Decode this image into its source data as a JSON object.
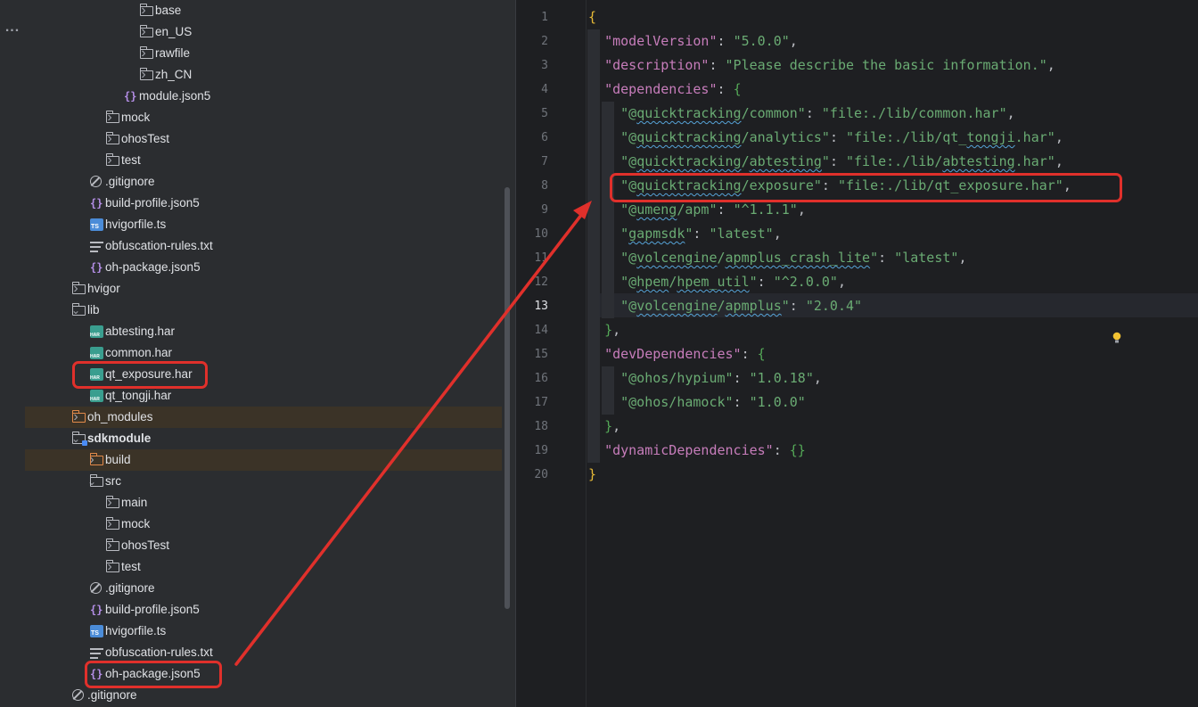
{
  "activity": {
    "more_label": "..."
  },
  "tree": {
    "rows": [
      {
        "label": "base",
        "icon": "folder-icon",
        "chev": "›"
      },
      {
        "label": "en_US",
        "icon": "folder-icon",
        "chev": "›"
      },
      {
        "label": "rawfile",
        "icon": "folder-icon",
        "chev": "›"
      },
      {
        "label": "zh_CN",
        "icon": "folder-icon",
        "chev": "›"
      },
      {
        "label": "module.json5",
        "icon": "json-file-icon",
        "chev": ""
      },
      {
        "label": "mock",
        "icon": "folder-icon",
        "chev": "›"
      },
      {
        "label": "ohosTest",
        "icon": "folder-icon",
        "chev": "›"
      },
      {
        "label": "test",
        "icon": "folder-icon",
        "chev": "›"
      },
      {
        "label": ".gitignore",
        "icon": "ignore-file-icon",
        "chev": ""
      },
      {
        "label": "build-profile.json5",
        "icon": "json-file-icon",
        "chev": ""
      },
      {
        "label": "hvigorfile.ts",
        "icon": "ts-file-icon",
        "chev": ""
      },
      {
        "label": "obfuscation-rules.txt",
        "icon": "text-file-icon",
        "chev": ""
      },
      {
        "label": "oh-package.json5",
        "icon": "json-file-icon",
        "chev": ""
      },
      {
        "label": "hvigor",
        "icon": "folder-icon",
        "chev": "›"
      },
      {
        "label": "lib",
        "icon": "folder-icon",
        "chev": "⌄"
      },
      {
        "label": "abtesting.har",
        "icon": "har-file-icon",
        "chev": ""
      },
      {
        "label": "common.har",
        "icon": "har-file-icon",
        "chev": ""
      },
      {
        "label": "qt_exposure.har",
        "icon": "har-file-icon",
        "chev": ""
      },
      {
        "label": "qt_tongji.har",
        "icon": "har-file-icon",
        "chev": ""
      },
      {
        "label": "oh_modules",
        "icon": "orange-folder-icon",
        "chev": "›"
      },
      {
        "label": "sdkmodule",
        "icon": "module-folder-icon",
        "chev": "⌄"
      },
      {
        "label": "build",
        "icon": "orange-folder-icon",
        "chev": "›"
      },
      {
        "label": "src",
        "icon": "folder-icon",
        "chev": "⌄"
      },
      {
        "label": "main",
        "icon": "folder-icon",
        "chev": "›"
      },
      {
        "label": "mock",
        "icon": "folder-icon",
        "chev": "›"
      },
      {
        "label": "ohosTest",
        "icon": "folder-icon",
        "chev": "›"
      },
      {
        "label": "test",
        "icon": "folder-icon",
        "chev": "›"
      },
      {
        "label": ".gitignore",
        "icon": "ignore-file-icon",
        "chev": ""
      },
      {
        "label": "build-profile.json5",
        "icon": "json-file-icon",
        "chev": ""
      },
      {
        "label": "hvigorfile.ts",
        "icon": "ts-file-icon",
        "chev": ""
      },
      {
        "label": "obfuscation-rules.txt",
        "icon": "text-file-icon",
        "chev": ""
      },
      {
        "label": "oh-package.json5",
        "icon": "json-file-icon",
        "chev": ""
      },
      {
        "label": ".gitignore",
        "icon": "ignore-file-icon",
        "chev": ""
      }
    ]
  },
  "editor": {
    "current_line": 13,
    "line_numbers": [
      "1",
      "2",
      "3",
      "4",
      "5",
      "6",
      "7",
      "8",
      "9",
      "10",
      "11",
      "12",
      "13",
      "14",
      "15",
      "16",
      "17",
      "18",
      "19",
      "20"
    ],
    "lines": [
      [
        {
          "t": "{",
          "c": "b"
        }
      ],
      [
        {
          "t": "  "
        },
        {
          "t": "\"modelVersion\"",
          "c": "k"
        },
        {
          "t": ": "
        },
        {
          "t": "\"5.0.0\"",
          "c": "s"
        },
        {
          "t": ","
        }
      ],
      [
        {
          "t": "  "
        },
        {
          "t": "\"description\"",
          "c": "k"
        },
        {
          "t": ": "
        },
        {
          "t": "\"Please describe the basic information.\"",
          "c": "s"
        },
        {
          "t": ","
        }
      ],
      [
        {
          "t": "  "
        },
        {
          "t": "\"dependencies\"",
          "c": "k"
        },
        {
          "t": ": "
        },
        {
          "t": "{",
          "c": "b2"
        }
      ],
      [
        {
          "t": "    "
        },
        {
          "t": "\"@",
          "c": "s"
        },
        {
          "t": "quicktracking",
          "c": "s",
          "u": true
        },
        {
          "t": "/common\"",
          "c": "s"
        },
        {
          "t": ": "
        },
        {
          "t": "\"file:./lib/common.har\"",
          "c": "s"
        },
        {
          "t": ","
        }
      ],
      [
        {
          "t": "    "
        },
        {
          "t": "\"@",
          "c": "s"
        },
        {
          "t": "quicktracking",
          "c": "s",
          "u": true
        },
        {
          "t": "/analytics\"",
          "c": "s"
        },
        {
          "t": ": "
        },
        {
          "t": "\"file:./lib/qt_",
          "c": "s"
        },
        {
          "t": "tongji",
          "c": "s",
          "u": true
        },
        {
          "t": ".har\"",
          "c": "s"
        },
        {
          "t": ","
        }
      ],
      [
        {
          "t": "    "
        },
        {
          "t": "\"@",
          "c": "s"
        },
        {
          "t": "quicktracking",
          "c": "s",
          "u": true
        },
        {
          "t": "/",
          "c": "s"
        },
        {
          "t": "abtesting",
          "c": "s",
          "u": true
        },
        {
          "t": "\"",
          "c": "s"
        },
        {
          "t": ": "
        },
        {
          "t": "\"file:./lib/",
          "c": "s"
        },
        {
          "t": "abtesting",
          "c": "s",
          "u": true
        },
        {
          "t": ".har\"",
          "c": "s"
        },
        {
          "t": ","
        }
      ],
      [
        {
          "t": "    "
        },
        {
          "t": "\"@",
          "c": "s"
        },
        {
          "t": "quicktracking",
          "c": "s",
          "u": true
        },
        {
          "t": "/exposure\"",
          "c": "s"
        },
        {
          "t": ": "
        },
        {
          "t": "\"file:./lib/qt_exposure.har\"",
          "c": "s"
        },
        {
          "t": ","
        }
      ],
      [
        {
          "t": "    "
        },
        {
          "t": "\"@",
          "c": "s"
        },
        {
          "t": "umeng",
          "c": "s",
          "u": true
        },
        {
          "t": "/apm\"",
          "c": "s"
        },
        {
          "t": ": "
        },
        {
          "t": "\"^1.1.1\"",
          "c": "s"
        },
        {
          "t": ","
        }
      ],
      [
        {
          "t": "    "
        },
        {
          "t": "\"",
          "c": "s"
        },
        {
          "t": "gapmsdk",
          "c": "s",
          "u": true
        },
        {
          "t": "\"",
          "c": "s"
        },
        {
          "t": ": "
        },
        {
          "t": "\"latest\"",
          "c": "s"
        },
        {
          "t": ","
        }
      ],
      [
        {
          "t": "    "
        },
        {
          "t": "\"@",
          "c": "s"
        },
        {
          "t": "volcengine",
          "c": "s",
          "u": true
        },
        {
          "t": "/",
          "c": "s"
        },
        {
          "t": "apmplus_crash_lite",
          "c": "s",
          "u": true
        },
        {
          "t": "\"",
          "c": "s"
        },
        {
          "t": ": "
        },
        {
          "t": "\"latest\"",
          "c": "s"
        },
        {
          "t": ","
        }
      ],
      [
        {
          "t": "    "
        },
        {
          "t": "\"@",
          "c": "s"
        },
        {
          "t": "hpem",
          "c": "s",
          "u": true
        },
        {
          "t": "/",
          "c": "s"
        },
        {
          "t": "hpem_util",
          "c": "s",
          "u": true
        },
        {
          "t": "\"",
          "c": "s"
        },
        {
          "t": ": "
        },
        {
          "t": "\"^2.0.0\"",
          "c": "s"
        },
        {
          "t": ","
        }
      ],
      [
        {
          "t": "    "
        },
        {
          "t": "\"@",
          "c": "s"
        },
        {
          "t": "volcengine",
          "c": "s",
          "u": true
        },
        {
          "t": "/",
          "c": "s"
        },
        {
          "t": "apmplus",
          "c": "s",
          "u": true
        },
        {
          "t": "\"",
          "c": "s"
        },
        {
          "t": ": "
        },
        {
          "t": "\"2.0.4\"",
          "c": "s"
        }
      ],
      [
        {
          "t": "  "
        },
        {
          "t": "}",
          "c": "b2"
        },
        {
          "t": ","
        }
      ],
      [
        {
          "t": "  "
        },
        {
          "t": "\"devDependencies\"",
          "c": "k"
        },
        {
          "t": ": "
        },
        {
          "t": "{",
          "c": "b2"
        }
      ],
      [
        {
          "t": "    "
        },
        {
          "t": "\"@ohos/hypium\"",
          "c": "s"
        },
        {
          "t": ": "
        },
        {
          "t": "\"1.0.18\"",
          "c": "s"
        },
        {
          "t": ","
        }
      ],
      [
        {
          "t": "    "
        },
        {
          "t": "\"@ohos/hamock\"",
          "c": "s"
        },
        {
          "t": ": "
        },
        {
          "t": "\"1.0.0\"",
          "c": "s"
        }
      ],
      [
        {
          "t": "  "
        },
        {
          "t": "}",
          "c": "b2"
        },
        {
          "t": ","
        }
      ],
      [
        {
          "t": "  "
        },
        {
          "t": "\"dynamicDependencies\"",
          "c": "k"
        },
        {
          "t": ": "
        },
        {
          "t": "{}",
          "c": "b2"
        }
      ],
      [
        {
          "t": "}",
          "c": "b"
        }
      ]
    ]
  },
  "annotations": {
    "color": "#e0302b"
  }
}
